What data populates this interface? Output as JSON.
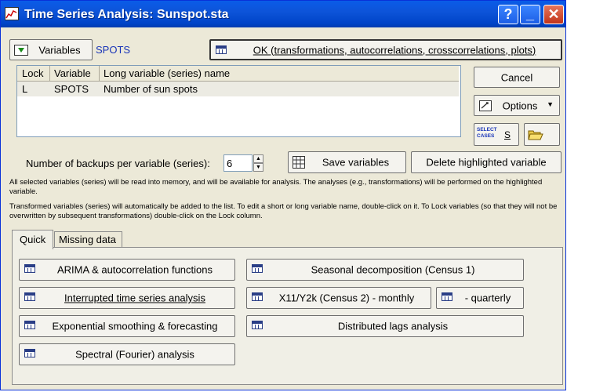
{
  "window": {
    "title": "Time Series Analysis: Sunspot.sta",
    "help_label": "?",
    "minimize_label": "_",
    "close_label": "✕"
  },
  "variables_button": "Variables",
  "selected_variable": "SPOTS",
  "ok_button": "OK (transformations, autocorrelations, crosscorrelations, plots)",
  "grid": {
    "columns": [
      "Lock",
      "Variable",
      "Long variable (series) name"
    ],
    "rows": [
      {
        "lock": "L",
        "variable": "SPOTS",
        "name": "Number of sun spots"
      }
    ]
  },
  "cancel_button": "Cancel",
  "options_button": "Options",
  "select_cases": {
    "icon_text_top": "SELECT",
    "icon_text_bottom": "CASES",
    "label": "S"
  },
  "backups_label": "Number of backups per variable (series):",
  "backups_value": "6",
  "save_variables_button": "Save variables",
  "delete_button": "Delete highlighted variable",
  "note1": "All selected variables (series) will be read into memory, and will be available for analysis. The analyses (e.g., transformations) will be performed on the highlighted variable.",
  "note2": "Transformed variables (series) will automatically be added to the list. To edit a short or long variable name, double-click on it. To Lock variables (so that they will not be overwritten by subsequent transformations) double-click on the Lock column.",
  "tabs": [
    "Quick",
    "Missing data"
  ],
  "quick": {
    "arima": "ARIMA & autocorrelation functions",
    "interrupted": "Interrupted time series analysis",
    "exponential": "Exponential smoothing & forecasting",
    "spectral": "Spectral (Fourier) analysis",
    "seasonal": "Seasonal decomposition (Census 1)",
    "x11_monthly": "X11/Y2k (Census 2) - monthly",
    "quarterly": "- quarterly",
    "distributed": "Distributed lags analysis"
  }
}
